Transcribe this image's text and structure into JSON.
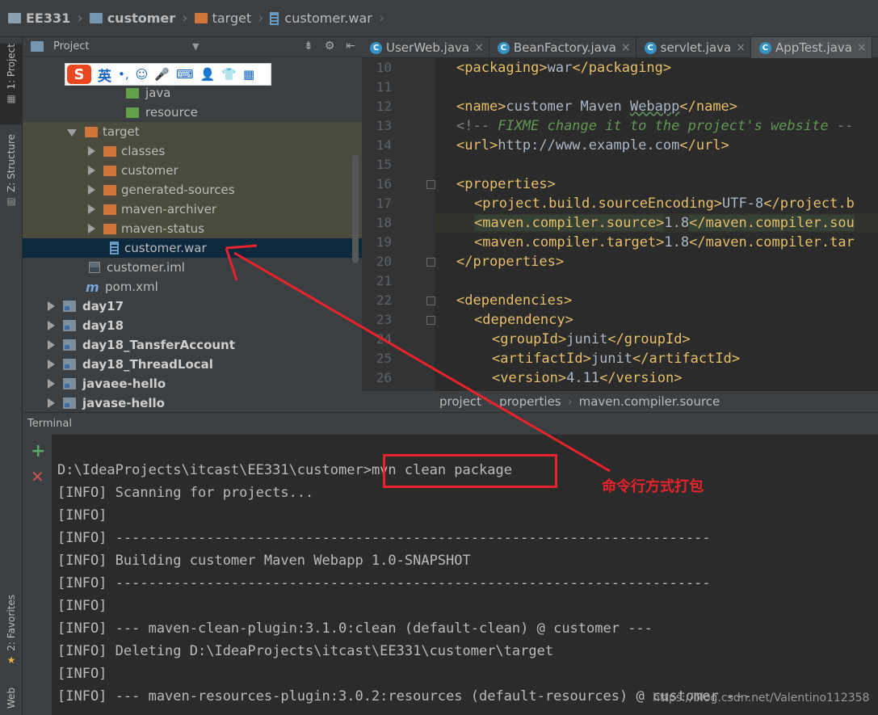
{
  "breadcrumbs": [
    "EE331",
    "customer",
    "target",
    "customer.war"
  ],
  "left_tool_tabs": [
    "1: Project",
    "Z: Structure",
    "2: Favorites",
    "Web"
  ],
  "project_panel": {
    "title": "Project",
    "tree": [
      {
        "label": "java",
        "icon": "green-folder-icon"
      },
      {
        "label": "resource",
        "icon": "green-folder-icon"
      },
      {
        "label": "target",
        "icon": "folder-icon",
        "expanded": true
      },
      {
        "label": "classes",
        "icon": "folder-icon"
      },
      {
        "label": "customer",
        "icon": "folder-icon"
      },
      {
        "label": "generated-sources",
        "icon": "folder-icon"
      },
      {
        "label": "maven-archiver",
        "icon": "folder-icon"
      },
      {
        "label": "maven-status",
        "icon": "folder-icon"
      },
      {
        "label": "customer.war",
        "icon": "war-file-icon",
        "selected": true
      },
      {
        "label": "customer.iml",
        "icon": "iml-file-icon"
      },
      {
        "label": "pom.xml",
        "icon": "maven-m-icon"
      },
      {
        "label": "day17",
        "icon": "module-folder-icon"
      },
      {
        "label": "day18",
        "icon": "module-folder-icon"
      },
      {
        "label": "day18_TansferAccount",
        "icon": "module-folder-icon"
      },
      {
        "label": "day18_ThreadLocal",
        "icon": "module-folder-icon"
      },
      {
        "label": "javaee-hello",
        "icon": "module-folder-icon"
      },
      {
        "label": "javase-hello",
        "icon": "module-folder-icon"
      }
    ]
  },
  "ime_toolbar": {
    "lang": "英",
    "punct": "•,"
  },
  "editor_tabs": [
    {
      "label": "UserWeb.java"
    },
    {
      "label": "BeanFactory.java"
    },
    {
      "label": "servlet.java"
    },
    {
      "label": "AppTest.java",
      "active": true
    }
  ],
  "editor": {
    "line_numbers": [
      "10",
      "11",
      "12",
      "13",
      "14",
      "15",
      "16",
      "17",
      "18",
      "19",
      "20",
      "21",
      "22",
      "23",
      "24",
      "25",
      "26"
    ],
    "lines": {
      "l10_open": "<packaging>",
      "l10_text": "war",
      "l10_close": "</packaging>",
      "l12_open": "<name>",
      "l12_text_a": "customer Maven ",
      "l12_text_b": "Webapp",
      "l12_close": "</name>",
      "l13_open": "<!-- ",
      "l13_text": "FIXME change it to the project's website",
      "l13_close": " --",
      "l14_open": "<url>",
      "l14_text": "http://www.example.com",
      "l14_close": "</url>",
      "l16": "<properties>",
      "l17_open": "<project.build.sourceEncoding>",
      "l17_text": "UTF-8",
      "l17_close": "</project.b",
      "l18_open": "<maven.compiler.source>",
      "l18_text": "1.8",
      "l18_close": "</maven.compiler.sou",
      "l19_open": "<maven.compiler.target>",
      "l19_text": "1.8",
      "l19_close": "</maven.compiler.tar",
      "l20": "</properties>",
      "l22": "<dependencies>",
      "l23": "<dependency>",
      "l24_open": "<groupId>",
      "l24_text": "junit",
      "l24_close": "</groupId>",
      "l25_open": "<artifactId>",
      "l25_text": "junit",
      "l25_close": "</artifactId>",
      "l26_open": "<version>",
      "l26_text": "4.11",
      "l26_close": "</version>"
    }
  },
  "editor_breadcrumb": [
    "project",
    "properties",
    "maven.compiler.source"
  ],
  "terminal": {
    "title": "Terminal",
    "prompt": "D:\\IdeaProjects\\itcast\\EE331\\customer>",
    "command": "mvn clean package",
    "lines": [
      "[INFO] Scanning for projects...",
      "[INFO]",
      "[INFO] ------------------------------------------------------------------------",
      "[INFO] Building customer Maven Webapp 1.0-SNAPSHOT",
      "[INFO] ------------------------------------------------------------------------",
      "[INFO]",
      "[INFO] --- maven-clean-plugin:3.1.0:clean (default-clean) @ customer ---",
      "[INFO] Deleting D:\\IdeaProjects\\itcast\\EE331\\customer\\target",
      "[INFO]",
      "[INFO] --- maven-resources-plugin:3.0.2:resources (default-resources) @ customer ---"
    ]
  },
  "annotation": {
    "text": "命令行方式打包",
    "color": "#e8232b"
  },
  "watermark": "https://blog.csdn.net/Valentino112358",
  "colors": {
    "tag": "#e8bf6a",
    "comment": "#629755",
    "selection": "#0d293e",
    "annotation": "#e8232b"
  }
}
